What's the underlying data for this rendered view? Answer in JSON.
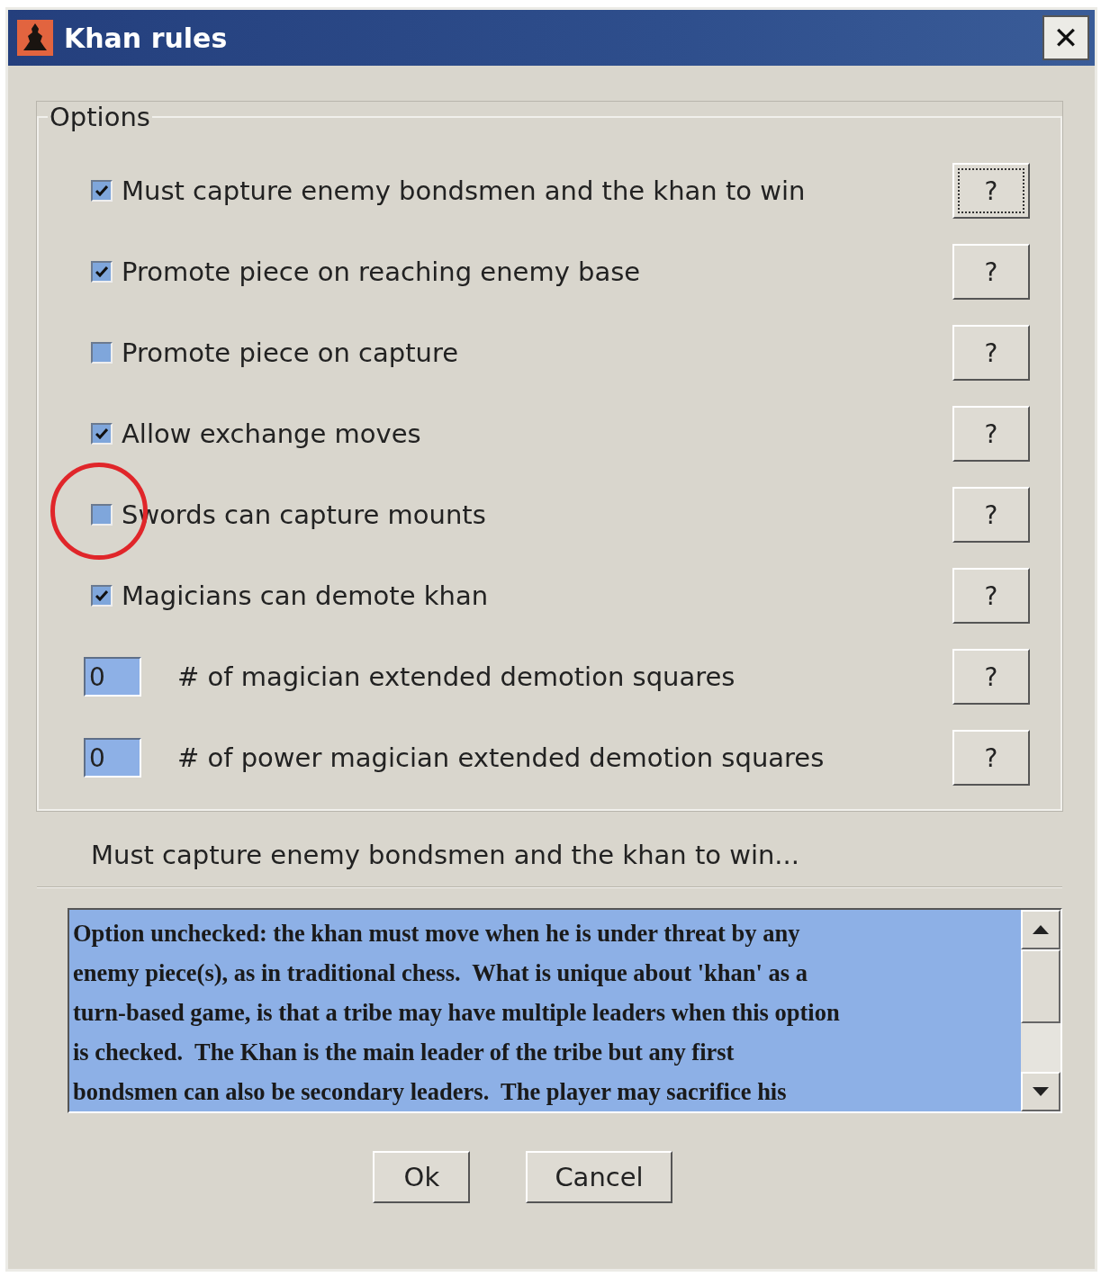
{
  "window": {
    "title": "Khan rules",
    "close": "✕"
  },
  "options_group": {
    "title": "Options",
    "items": [
      {
        "kind": "checkbox",
        "label": "Must capture enemy bondsmen and the khan to win",
        "checked": true,
        "help": "?",
        "help_focused": true,
        "highlighted": false
      },
      {
        "kind": "checkbox",
        "label": "Promote piece on reaching enemy base",
        "checked": true,
        "help": "?",
        "help_focused": false,
        "highlighted": false
      },
      {
        "kind": "checkbox",
        "label": "Promote piece on capture",
        "checked": false,
        "help": "?",
        "help_focused": false,
        "highlighted": false
      },
      {
        "kind": "checkbox",
        "label": "Allow exchange moves",
        "checked": true,
        "help": "?",
        "help_focused": false,
        "highlighted": false
      },
      {
        "kind": "checkbox",
        "label": "Swords can capture mounts",
        "checked": false,
        "help": "?",
        "help_focused": false,
        "highlighted": true
      },
      {
        "kind": "checkbox",
        "label": "Magicians can demote khan",
        "checked": true,
        "help": "?",
        "help_focused": false,
        "highlighted": false
      },
      {
        "kind": "number",
        "label": "# of magician extended demotion squares",
        "value": "0",
        "help": "?",
        "help_focused": false,
        "highlighted": false
      },
      {
        "kind": "number",
        "label": "# of power magician extended demotion squares",
        "value": "0",
        "help": "?",
        "help_focused": false,
        "highlighted": false
      }
    ]
  },
  "description_title": "Must capture enemy bondsmen and the khan to win...",
  "description_lines": [
    "Option unchecked: the khan must move when he is under threat by any",
    "enemy piece(s), as in traditional chess.  What is unique about 'khan' as a",
    "turn-based game, is that a tribe may have multiple leaders when this option",
    "is checked.  The Khan is the main leader of the tribe but any first",
    "bondsmen can also be secondary leaders.  The player may sacrifice his"
  ],
  "buttons": [
    {
      "label": "Ok"
    },
    {
      "label": "Cancel"
    }
  ]
}
